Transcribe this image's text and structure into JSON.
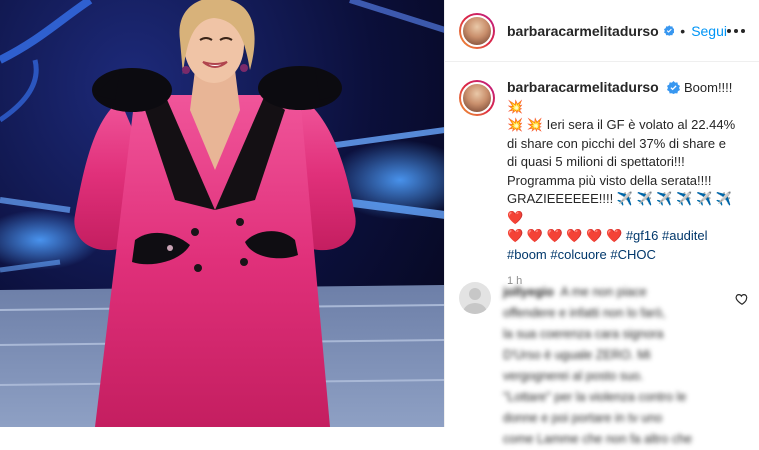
{
  "post": {
    "username": "barbaracarmelitadurso",
    "follow_label": "Segui",
    "dot": "•",
    "caption_lines": [
      "Boom!!!! 💥",
      "💥 💥 Ieri sera il GF è volato al 22.44%",
      "di share con picchi del 37% di share e",
      "di quasi 5 milioni di spettatori!!!",
      "Programma più visto della serata!!!!",
      "GRAZIEEEEEE!!!! ✈️ ✈️ ✈️ ✈️ ✈️ ✈️ ❤️",
      "❤️ ❤️ ❤️ ❤️ ❤️ ❤️"
    ],
    "hashtags_line1": [
      "#gf16",
      "#auditel"
    ],
    "hashtags_line2": [
      "#boom",
      "#colcuore",
      "#CHOC"
    ],
    "timestamp": "1 h"
  },
  "comment": {
    "username": "jollyegio",
    "text_lines": [
      "A me non piace",
      "offendere e infatti non lo farò,",
      "la sua coerenza cara signora",
      "D'Urso è uguale ZERO. Mi",
      "vergognerei al posto suo.",
      "\"Lottare\" per la violenza contro le",
      "donne e poi portare in tv uno",
      "come Lamme che non fa altro che"
    ]
  },
  "colors": {
    "follow": "#0095f6",
    "verified": "#3897f0",
    "hashtag": "#00376b",
    "dress": "#e0307a"
  },
  "icons": [
    "verified-badge-icon",
    "more-options-icon",
    "heart-icon"
  ]
}
